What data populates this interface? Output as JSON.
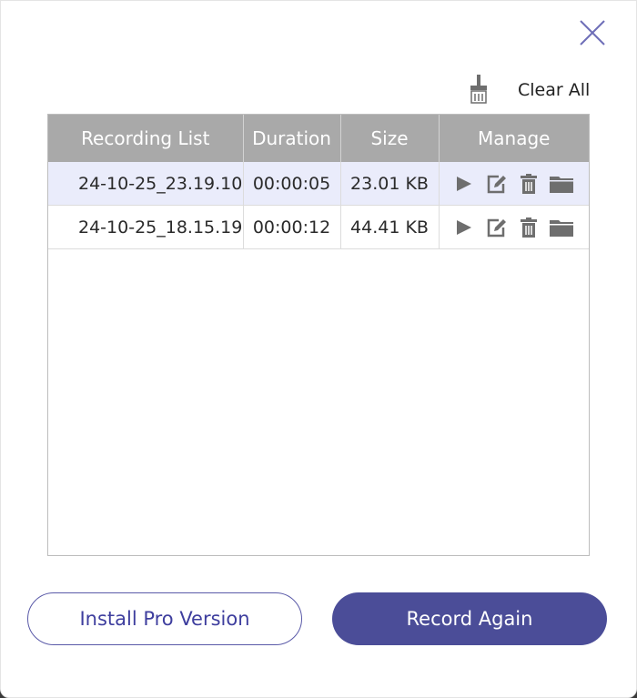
{
  "header": {
    "close_icon": "close-icon",
    "clear_all_icon": "broom-icon",
    "clear_all_label": "Clear All"
  },
  "table": {
    "columns": [
      "Recording List",
      "Duration",
      "Size",
      "Manage"
    ],
    "rows": [
      {
        "name": "24-10-25_23.19.10",
        "duration": "00:00:05",
        "size": "23.01 KB",
        "selected": true
      },
      {
        "name": "24-10-25_18.15.19",
        "duration": "00:00:12",
        "size": "44.41 KB",
        "selected": false
      }
    ],
    "manage_icons": [
      "play-icon",
      "edit-icon",
      "trash-icon",
      "folder-icon"
    ]
  },
  "footer": {
    "install_pro_label": "Install Pro Version",
    "record_again_label": "Record Again"
  },
  "colors": {
    "accent": "#4b4d98",
    "header_bg": "#a9a9a9",
    "selected_row_bg": "#eaecfb",
    "icon_gray": "#6e6e6e"
  }
}
